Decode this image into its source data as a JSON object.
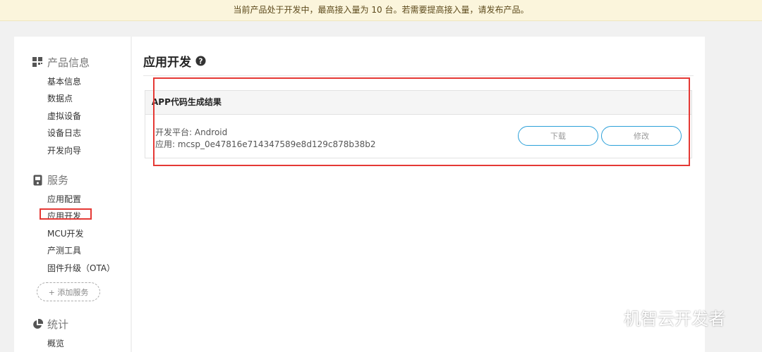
{
  "banner": {
    "text": "当前产品处于开发中，最高接入量为 10 台。若需要提高接入量，请发布产品。"
  },
  "sidebar": {
    "product_info": {
      "title": "产品信息",
      "icon": "grid-icon",
      "items": [
        "基本信息",
        "数据点",
        "虚拟设备",
        "设备日志",
        "开发向导"
      ]
    },
    "service": {
      "title": "服务",
      "icon": "device-icon",
      "items": [
        "应用配置",
        "应用开发",
        "MCU开发",
        "产测工具",
        "固件升级（OTA）"
      ],
      "active_item": "应用开发"
    },
    "add_service_label": "+ 添加服务",
    "stats": {
      "title": "统计",
      "icon": "pie-chart-icon",
      "items": [
        "概览"
      ]
    }
  },
  "main": {
    "title": "应用开发",
    "help_icon": "help-circle-icon",
    "card": {
      "title": "APP代码生成结果",
      "platform_line": "开发平台: Android",
      "app_line": "应用: mcsp_0e47816e714347589e8d129c878b38b2",
      "download_label": "下载",
      "edit_label": "修改"
    }
  },
  "watermark": {
    "text": "机智云开发者",
    "icon": "wechat-icon"
  },
  "colors": {
    "banner_bg": "#fbf5dc",
    "accent_blue": "#2ba0d9",
    "highlight_red": "#e53935",
    "page_bg": "#f1f1f1"
  }
}
